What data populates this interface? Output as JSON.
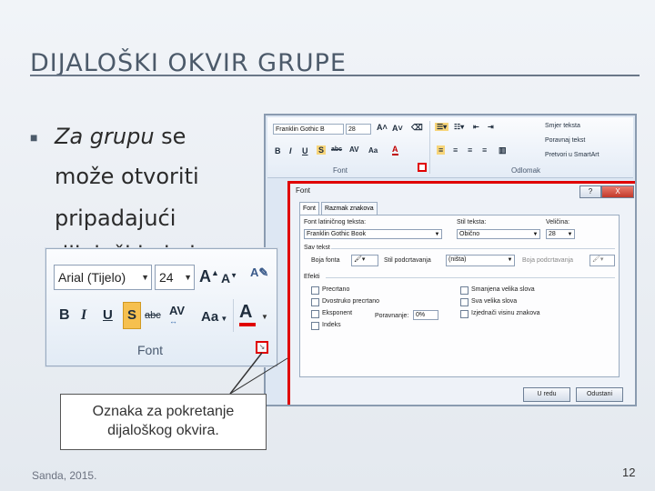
{
  "slide": {
    "title": "DIJALOŠKI OKVIR GRUPE",
    "body_emph": "Za grupu",
    "body_rest": " se",
    "line2": "može otvoriti",
    "line3": "pripadajući",
    "line4_partial": "dijaloški okvir",
    "footer": "Sanda, 2015.",
    "page": "12"
  },
  "ribbon": {
    "font_name": "Franklin Gothic B",
    "font_size": "28",
    "group_font_label": "Font",
    "group_paragraph_label": "Odlomak",
    "items": [
      "Smjer teksta",
      "Poravnaj tekst",
      "Pretvori u SmartArt"
    ]
  },
  "dialog": {
    "title": "Font",
    "close_symbol": "X",
    "help_symbol": "?",
    "tabs": [
      "Font",
      "Razmak znakova"
    ],
    "latin_label": "Font latiničnog teksta:",
    "latin_value": "Franklin Gothic Book",
    "style_label": "Stil teksta:",
    "style_value": "Obično",
    "size_label": "Veličina:",
    "size_value": "28",
    "all_text_label": "Sav tekst",
    "font_color_label": "Boja fonta",
    "underline_style_label": "Stil podcrtavanja",
    "underline_value": "(ništa)",
    "underline_color_label": "Boja podcrtavanja",
    "effects_label": "Efekti",
    "effects_left": [
      "Precrtano",
      "Dvostruko precrtano",
      "Eksponent",
      "Indeks"
    ],
    "effects_right": [
      "Smanjena velika slova",
      "Sva velika slova",
      "Izjednači visinu znakova"
    ],
    "offset_label": "Poravnanje:",
    "offset_value": "0%",
    "ok_label": "U redu",
    "cancel_label": "Odustani"
  },
  "inset": {
    "font_name": "Arial (Tijelo)",
    "font_size": "24",
    "group_label": "Font",
    "bold": "B",
    "italic": "I",
    "underline": "U",
    "shadow": "S",
    "strike": "abc",
    "spacing": "AV",
    "case": "Aa",
    "color_a": "A"
  },
  "callout": {
    "line1": "Oznaka za pokretanje",
    "line2": "dijaloškog okvira."
  },
  "colors": {
    "highlight": "#e00000",
    "title": "#4c5a6a"
  }
}
